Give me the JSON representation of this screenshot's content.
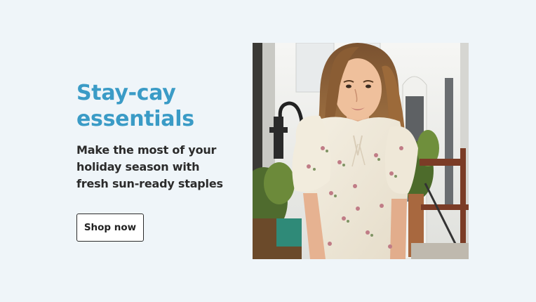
{
  "promo": {
    "headline": "Stay-cay essentials",
    "subhead": "Make the most of your\nholiday season with\nfresh sun-ready staples",
    "cta_label": "Shop now"
  },
  "image": {
    "alt": "Woman in a cream floral puff-sleeve blouse outside a white building with potted plants"
  },
  "colors": {
    "background": "#eff5f9",
    "headline": "#3a9bc6",
    "body_text": "#2b2b2b",
    "button_border": "#2b2b2b"
  }
}
